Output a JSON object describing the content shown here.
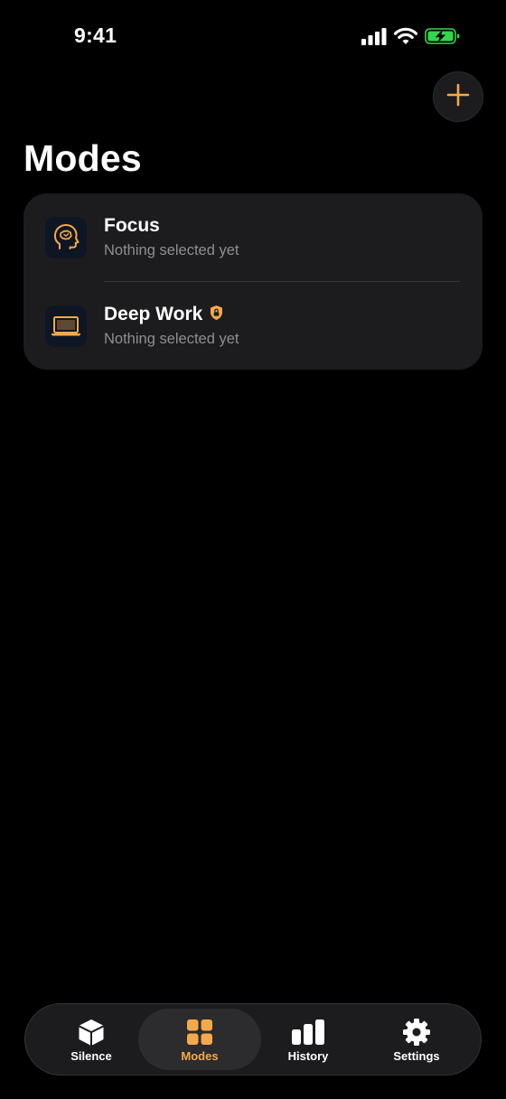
{
  "status_bar": {
    "time": "9:41"
  },
  "header": {
    "title": "Modes"
  },
  "modes": [
    {
      "name": "Focus",
      "subtitle": "Nothing selected yet",
      "icon": "head-brain-icon",
      "locked": false
    },
    {
      "name": "Deep Work",
      "subtitle": "Nothing selected yet",
      "icon": "laptop-icon",
      "locked": true
    }
  ],
  "tab_bar": {
    "tabs": [
      {
        "label": "Silence",
        "icon": "cube-icon",
        "active": false
      },
      {
        "label": "Modes",
        "icon": "grid-icon",
        "active": true
      },
      {
        "label": "History",
        "icon": "bar-chart-icon",
        "active": false
      },
      {
        "label": "Settings",
        "icon": "gear-icon",
        "active": false
      }
    ]
  },
  "colors": {
    "accent": "#f5a94a",
    "background": "#000000",
    "card": "#1c1c1e",
    "secondary_text": "#8e8e93",
    "battery_charging": "#32d74b"
  }
}
